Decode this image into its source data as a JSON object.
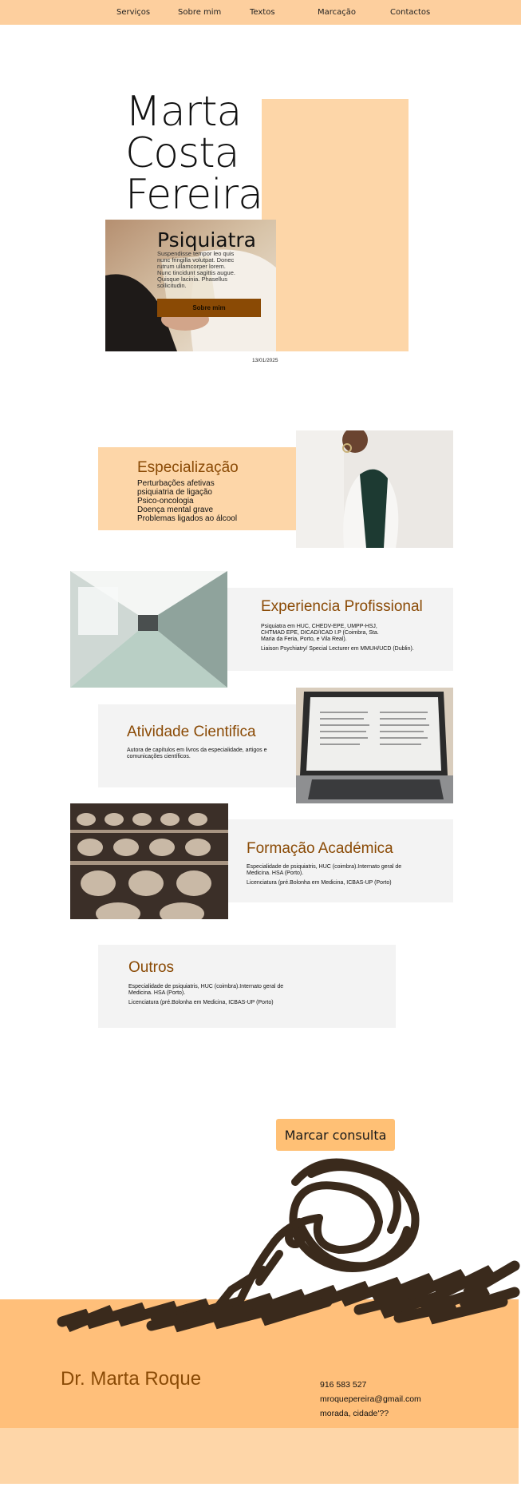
{
  "nav": {
    "items": [
      "Serviços",
      "Sobre mim",
      "Textos",
      "Marcação",
      "Contactos"
    ]
  },
  "hero": {
    "name_line1": "Marta",
    "name_line2": "Costa",
    "name_line3": "Fereira",
    "subtitle": "Psiquiatra",
    "body": "Suspendisse tempor leo quis nunc fringilla volutpat. Donec rutrum ullamcorper lorem. Nunc tincidunt sagittis augue. Quisque lacinia. Phasellus sollicitudin.",
    "button_label": "Sobre mim",
    "date": "13/01/2025"
  },
  "especializacao": {
    "title": "Especialização",
    "items": [
      "Perturbações afetivas",
      "psiquiatria de ligação",
      "Psico-oncologia",
      "Doença mental grave",
      "Problemas ligados ao álcool"
    ]
  },
  "experiencia": {
    "title": "Experiencia Profissional",
    "para1": "Psiquiatra em HUC, CHEDV-EPE, UMPP-HSJ, CHTMAD EPE, DICAD/ICAD I.P (Coimbra, Sta. Maria da Feria, Porto, e Vila Real).",
    "para2": "Liaison Psychiatry/ Special Lecturer em MMUH/UCD (Dublin)."
  },
  "atividade": {
    "title": "Atividade Cientifica",
    "para1": "Autora de capítulos em livros da especialidade, artigos e comunicações científicos."
  },
  "formacao": {
    "title": "Formação Académica",
    "para1": "Especialidade de psiquiatris, HUC (coimbra).Internato geral de Medicina. HSA (Porto).",
    "para2": "Licenciatura (pré.Bolonha em Medicina, ICBAS-UP (Porto)"
  },
  "outros": {
    "title": "Outros",
    "para1": "Especialidade de psiquiatris, HUC (coimbra).Internato geral de Medicina. HSA (Porto).",
    "para2": "Licenciatura (pré.Bolonha em Medicina, ICBAS-UP (Porto)"
  },
  "cta": {
    "label": "Marcar consulta"
  },
  "footer": {
    "name": "Dr. Marta Roque",
    "phone": "916 583 527",
    "email": "mroquepereira@gmail.com",
    "address": "morada, cidade'??"
  },
  "colors": {
    "nav_bg": "#fdcf9e",
    "accent_brown": "#8a4a05",
    "panel_orange": "#fdd6a8",
    "panel_grey": "#f3f3f3",
    "footer_bg": "#ffbf7a"
  }
}
